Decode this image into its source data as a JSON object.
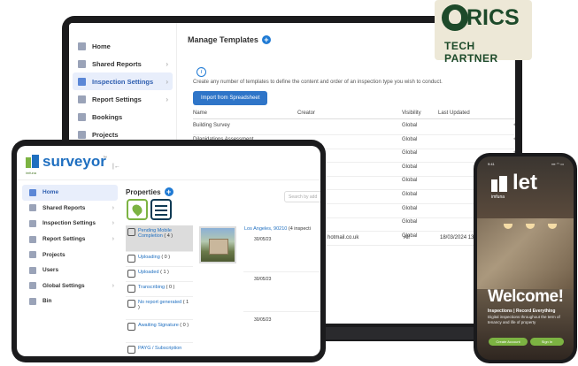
{
  "laptop": {
    "sidebar": [
      {
        "label": "Home",
        "chevron": false
      },
      {
        "label": "Shared Reports",
        "chevron": true
      },
      {
        "label": "Inspection Settings",
        "chevron": true,
        "active": true
      },
      {
        "label": "Report Settings",
        "chevron": true
      },
      {
        "label": "Bookings",
        "chevron": false
      },
      {
        "label": "Projects",
        "chevron": false
      }
    ],
    "title": "Manage Templates",
    "add_symbol": "+",
    "info_symbol": "i",
    "description": "Create any number of templates to define the content and order of an inspection type you wish to conduct.",
    "import_button": "Import from Spreadsheet",
    "columns": [
      "Name",
      "Creator",
      "Visibility",
      "Last Updated"
    ],
    "rows": [
      {
        "name": "Building Survey",
        "visibility": "Global"
      },
      {
        "name": "Dilapidations Assessment",
        "visibility": "Global"
      },
      {
        "name": "Schedule of Condition",
        "visibility": "Global"
      },
      {
        "name": "",
        "visibility": "Global"
      },
      {
        "name": "",
        "visibility": "Global"
      },
      {
        "name": "",
        "visibility": "Global"
      },
      {
        "name": "",
        "visibility": "Global"
      },
      {
        "name": "",
        "visibility": "Global"
      },
      {
        "name": "",
        "visibility": "Global"
      }
    ],
    "peek_email": "hotmail.co.uk",
    "peek_visibility": "All",
    "peek_date": "18/03/2024 13:"
  },
  "rics": {
    "word": "RICS",
    "subtitle": "TECH PARTNER"
  },
  "tablet": {
    "logo_text": "surveyor",
    "logo_small": "imfuna",
    "tm": "™",
    "collapse_icon": "|←",
    "sidebar": [
      {
        "label": "Home",
        "chevron": false,
        "active": true
      },
      {
        "label": "Shared Reports",
        "chevron": true
      },
      {
        "label": "Inspection Settings",
        "chevron": true
      },
      {
        "label": "Report Settings",
        "chevron": true
      },
      {
        "label": "Projects",
        "chevron": false
      },
      {
        "label": "Users",
        "chevron": false
      },
      {
        "label": "Global Settings",
        "chevron": true
      },
      {
        "label": "Bin",
        "chevron": false
      }
    ],
    "properties_title": "Properties",
    "add_symbol": "+",
    "search_placeholder": "Search by add",
    "statuses": [
      {
        "label": "Pending Mobile Completion",
        "count": "( 4 )",
        "active": true
      },
      {
        "label": "Uploading",
        "count": "( 0 )"
      },
      {
        "label": "Uploaded",
        "count": "( 1 )"
      },
      {
        "label": "Transcribing",
        "count": "( 0 )"
      },
      {
        "label": "No report generated",
        "count": "( 1 )",
        "tall": true
      },
      {
        "label": "Awaiting Signature",
        "count": "( 0 )",
        "tall": true
      },
      {
        "label": "PAYG / Subscription",
        "count": ""
      }
    ],
    "property_address": "Los Angeles, 90210",
    "property_count": "(4 inspecti",
    "dates": [
      "30/05/23",
      "30/05/23",
      "30/05/23"
    ]
  },
  "phone": {
    "status_time": "9:41",
    "status_icons": "▪▪▪ ◠ ▭",
    "brand": "let",
    "brand_small": "imfuna",
    "welcome": "Welcome!",
    "tagline": "Inspections | Record Everything",
    "description": "Digital inspections throughout the term of tenancy and life of property",
    "buttons": [
      "Create Account",
      "Sign In"
    ]
  }
}
